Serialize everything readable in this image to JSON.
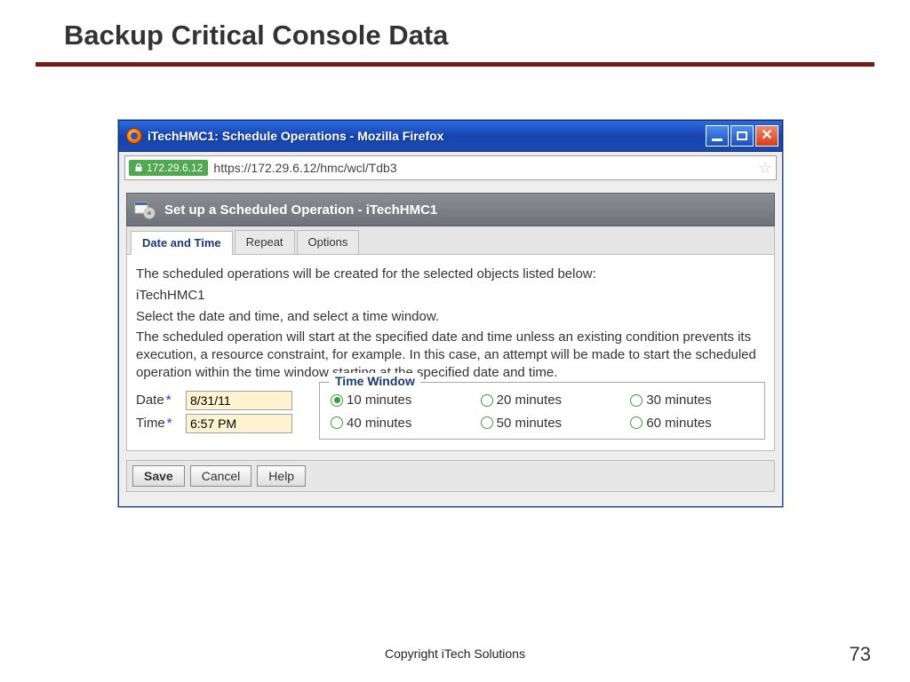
{
  "slide": {
    "title": "Backup Critical Console Data",
    "copyright": "Copyright iTech Solutions",
    "page_number": "73"
  },
  "window": {
    "title": "iTechHMC1: Schedule Operations - Mozilla Firefox",
    "address_host": "172.29.6.12",
    "address_url": "https://172.29.6.12/hmc/wcl/Tdb3"
  },
  "page_header": "Set up a Scheduled Operation - iTechHMC1",
  "tabs": {
    "date_time": "Date and Time",
    "repeat": "Repeat",
    "options": "Options"
  },
  "content": {
    "intro": "The scheduled operations will be created for the selected objects listed below:",
    "object": "iTechHMC1",
    "select_text": "Select the date and time, and select a time window.",
    "explain": "The scheduled operation will start at the specified date and time unless an existing condition prevents its execution, a resource constraint, for example. In this case, an attempt will be made to start the scheduled operation within the time window starting at the specified date and time."
  },
  "form": {
    "date_label": "Date",
    "time_label": "Time",
    "required_marker": "*",
    "date_value": "8/31/11",
    "time_value": "6:57 PM",
    "tw_legend": "Time Window",
    "options": {
      "o10": "10 minutes",
      "o20": "20 minutes",
      "o30": "30 minutes",
      "o40": "40 minutes",
      "o50": "50 minutes",
      "o60": "60 minutes"
    }
  },
  "buttons": {
    "save": "Save",
    "cancel": "Cancel",
    "help": "Help"
  }
}
